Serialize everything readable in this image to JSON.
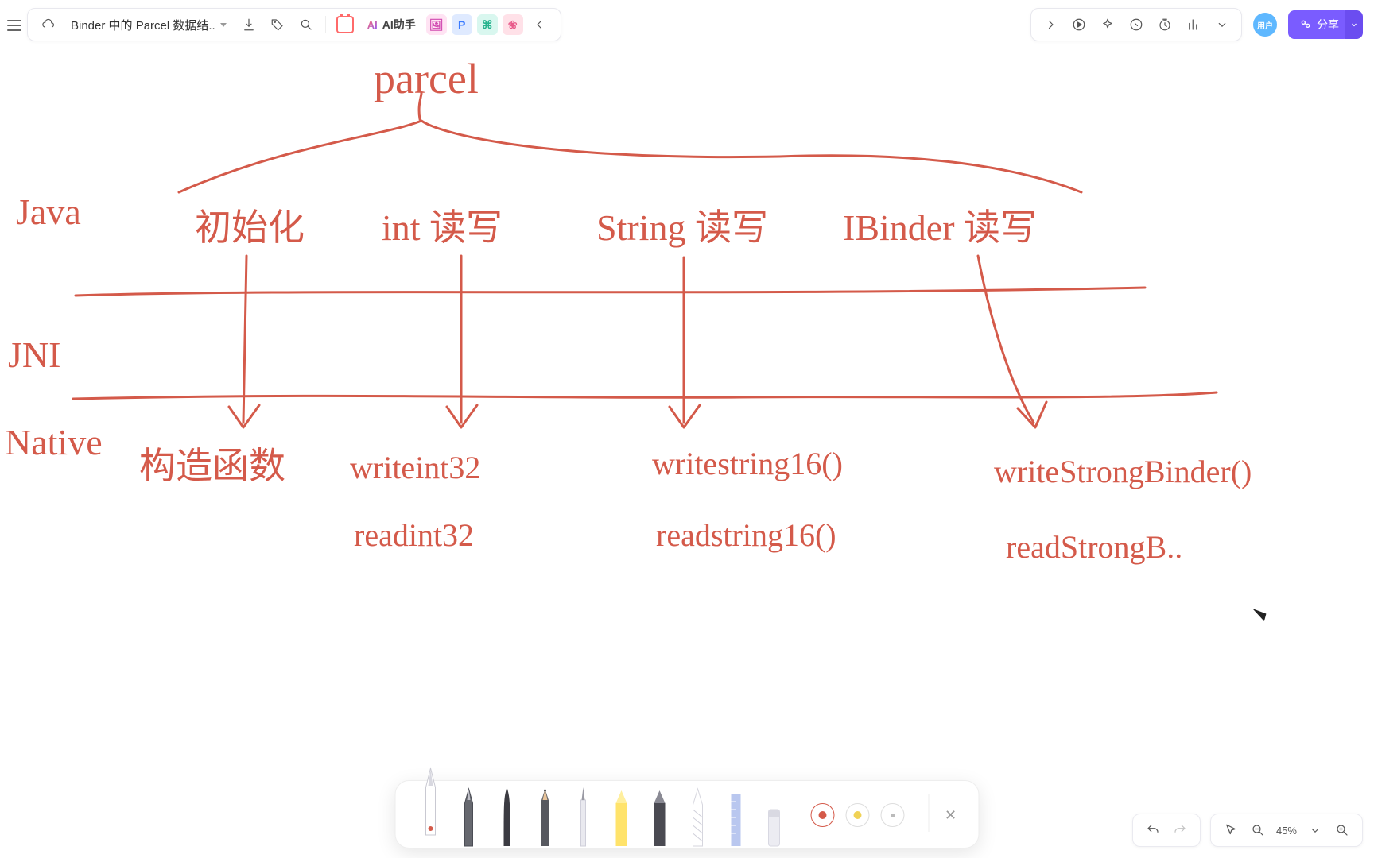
{
  "header": {
    "doc_title": "Binder 中的 Parcel 数据结..",
    "ai_label": "AI助手",
    "ai_logo": "AI",
    "avatar_label": "用户",
    "share_label": "分享",
    "mini_tiles": [
      "🖼",
      "P",
      "⌘",
      "❀"
    ]
  },
  "canvas": {
    "title": "parcel",
    "layers": {
      "java": "Java",
      "jni": "JNI",
      "native": "Native"
    },
    "cols": {
      "c1": "初始化",
      "c2": "int 读写",
      "c3": "String 读写",
      "c4": "IBinder 读写"
    },
    "native_rows": {
      "n1": "构造函数",
      "n2a": "writeint32",
      "n2b": "readint32",
      "n3a": "writestring16()",
      "n3b": "readstring16()",
      "n4a": "writeStrongBinder()",
      "n4b": "readStrongB.."
    }
  },
  "footer": {
    "zoom": "45%"
  },
  "colors": {
    "ink": "#d45a4a",
    "accent": "#7a5cff"
  }
}
